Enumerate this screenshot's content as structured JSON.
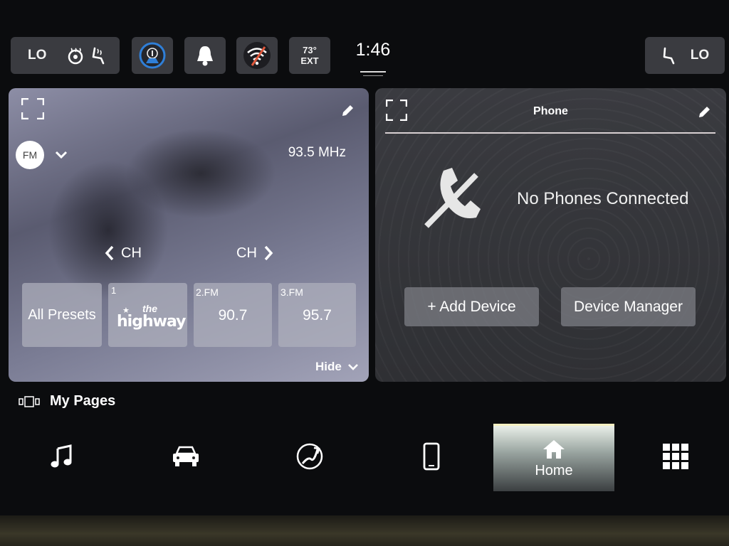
{
  "status_bar": {
    "left_climate_level": "LO",
    "outside_temp": "73°",
    "outside_temp_label": "EXT",
    "clock": "1:46",
    "right_climate_level": "LO"
  },
  "radio_panel": {
    "band": "FM",
    "frequency": "93.5 MHz",
    "ch_prev_label": "CH",
    "ch_next_label": "CH",
    "all_presets_label": "All Presets",
    "presets": [
      {
        "number": "1",
        "logo_top": "the",
        "logo_bottom": "highway"
      },
      {
        "number": "2.FM",
        "value": "90.7"
      },
      {
        "number": "3.FM",
        "value": "95.7"
      }
    ],
    "hide_label": "Hide"
  },
  "phone_panel": {
    "title": "Phone",
    "status": "No Phones Connected",
    "add_device_label": "+ Add Device",
    "device_manager_label": "Device Manager"
  },
  "my_pages_label": "My Pages",
  "nav": {
    "home_label": "Home"
  },
  "colors": {
    "accent_blue": "#2f7fd8",
    "wifi_off_red": "#e0583c",
    "home_highlight": "#f6f0c0"
  }
}
